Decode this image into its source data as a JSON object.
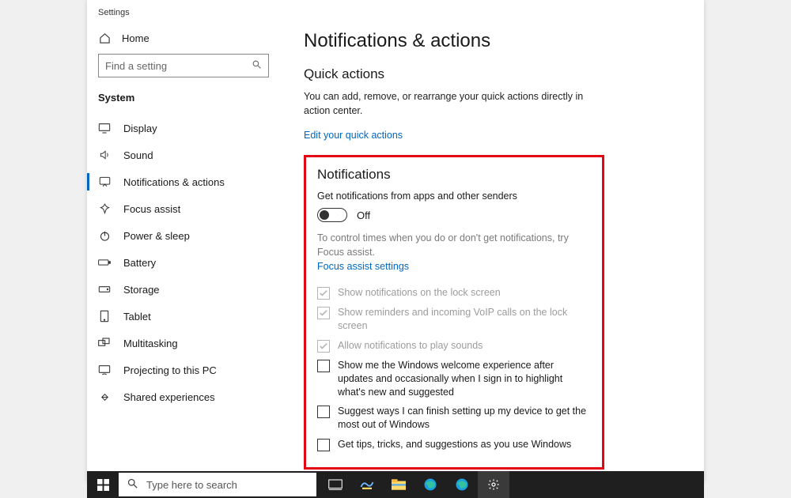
{
  "app_title": "Settings",
  "sidebar": {
    "home_label": "Home",
    "search_placeholder": "Find a setting",
    "section": "System",
    "items": [
      {
        "label": "Display"
      },
      {
        "label": "Sound"
      },
      {
        "label": "Notifications & actions"
      },
      {
        "label": "Focus assist"
      },
      {
        "label": "Power & sleep"
      },
      {
        "label": "Battery"
      },
      {
        "label": "Storage"
      },
      {
        "label": "Tablet"
      },
      {
        "label": "Multitasking"
      },
      {
        "label": "Projecting to this PC"
      },
      {
        "label": "Shared experiences"
      }
    ]
  },
  "main": {
    "title": "Notifications & actions",
    "quick_actions_heading": "Quick actions",
    "quick_actions_desc": "You can add, remove, or rearrange your quick actions directly in action center.",
    "quick_actions_link": "Edit your quick actions",
    "notifications_heading": "Notifications",
    "get_notifications_label": "Get notifications from apps and other senders",
    "toggle_state_label": "Off",
    "focus_desc": "To control times when you do or don't get notifications, try Focus assist.",
    "focus_link": "Focus assist settings",
    "check_disabled": [
      "Show notifications on the lock screen",
      "Show reminders and incoming VoIP calls on the lock screen",
      "Allow notifications to play sounds"
    ],
    "check_enabled": [
      "Show me the Windows welcome experience after updates and occasionally when I sign in to highlight what's new and suggested",
      "Suggest ways I can finish setting up my device to get the most out of Windows",
      "Get tips, tricks, and suggestions as you use Windows"
    ]
  },
  "taskbar": {
    "search_placeholder": "Type here to search"
  }
}
